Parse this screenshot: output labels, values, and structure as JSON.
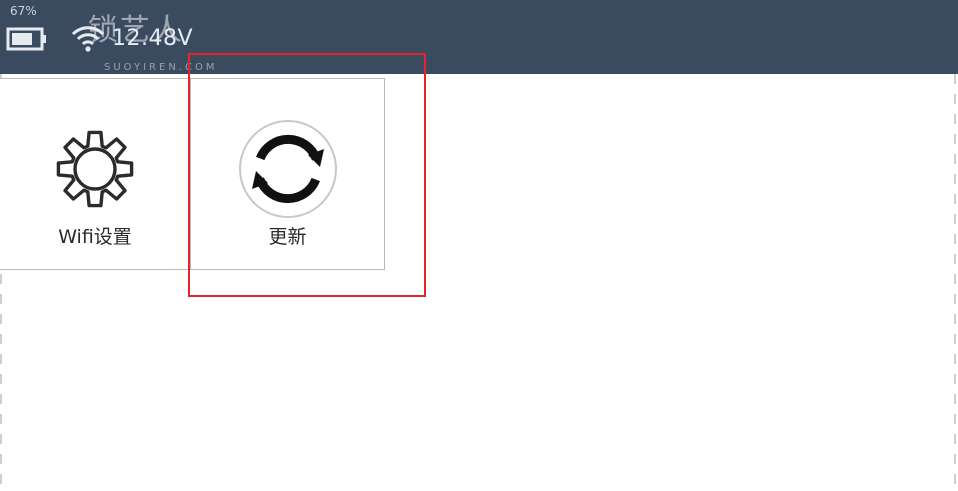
{
  "status_bar": {
    "battery_percent": "67%",
    "voltage": "12.48V",
    "battery_icon": "battery-icon",
    "wifi_icon": "wifi-icon"
  },
  "watermark": {
    "brand": "锁艺人",
    "url": "SUOYIREN.COM"
  },
  "tiles": [
    {
      "label": "Wifi设置",
      "icon": "gear-icon"
    },
    {
      "label": "更新",
      "icon": "refresh-icon"
    }
  ],
  "colors": {
    "status_bar": "#3a4b60",
    "highlight": "#e3262c"
  }
}
